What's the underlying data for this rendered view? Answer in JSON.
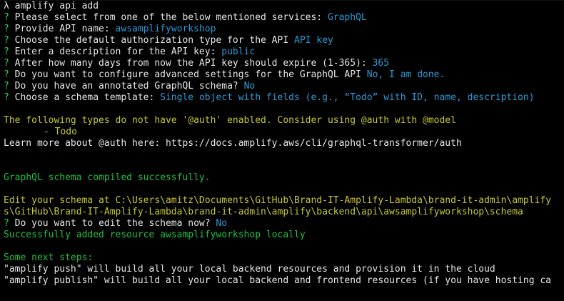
{
  "terminal": {
    "command_prompt": "λ",
    "command": "amplify api add",
    "qmark": "?",
    "prompts": [
      {
        "question": "Please select from one of the below mentioned services:",
        "answer": "GraphQL"
      },
      {
        "question": "Provide API name:",
        "answer": "awsamplifyworkshop"
      },
      {
        "question": "Choose the default authorization type for the API",
        "answer": "API key"
      },
      {
        "question": "Enter a description for the API key:",
        "answer": "public"
      },
      {
        "question": "After how many days from now the API key should expire (1-365):",
        "answer": "365"
      },
      {
        "question": "Do you want to configure advanced settings for the GraphQL API",
        "answer": "No, I am done."
      },
      {
        "question": "Do you have an annotated GraphQL schema?",
        "answer": "No"
      },
      {
        "question": "Choose a schema template:",
        "answer": "Single object with fields (e.g., “Todo” with ID, name, description)"
      }
    ],
    "warning_line": "The following types do not have '@auth' enabled. Consider using @auth with @model",
    "warning_type": "- Todo",
    "learn_more": "Learn more about @auth here: https://docs.amplify.aws/cli/graphql-transformer/auth",
    "compiled": "GraphQL schema compiled successfully.",
    "edit_line_1": "Edit your schema at C:\\Users\\amitz\\Documents\\GitHub\\Brand-IT-Amplify-Lambda\\brand-it-admin\\amplify",
    "edit_line_2": "s\\GitHub\\Brand-IT-Amplify-Lambda\\brand-it-admin\\amplify\\backend\\api\\awsamplifyworkshop\\schema",
    "edit_question": "Do you want to edit the schema now?",
    "edit_answer": "No",
    "added": "Successfully added resource awsamplifyworkshop locally",
    "next_steps_title": "Some next steps:",
    "next_steps": [
      "\"amplify push\" will build all your local backend resources and provision it in the cloud",
      "\"amplify publish\" will build all your local backend and frontend resources (if you have hosting ca"
    ],
    "colors": {
      "background": "#000000",
      "text": "#e6e6e6",
      "success": "#1fbf44",
      "answer": "#2a9bd6",
      "warning": "#c8c832",
      "question_mark": "#2fd35a"
    }
  }
}
